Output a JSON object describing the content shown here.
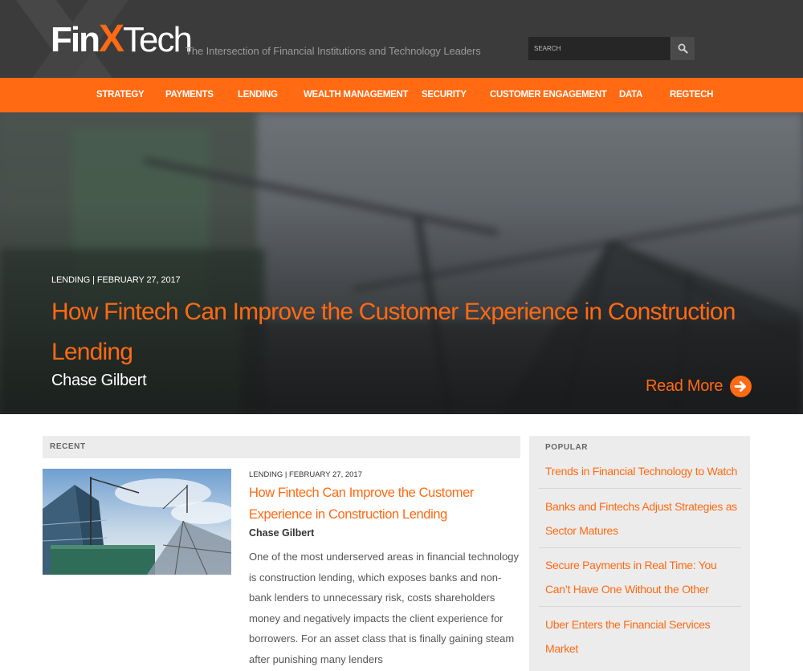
{
  "header": {
    "logo": {
      "fin": "Fin",
      "x": "X",
      "tech": "Tech"
    },
    "tagline": "The Intersection of Financial Institutions and Technology Leaders",
    "search": {
      "placeholder": "SEARCH",
      "icon": "search-icon"
    }
  },
  "nav": {
    "items": [
      {
        "label": "STRATEGY"
      },
      {
        "label": "PAYMENTS"
      },
      {
        "label": "LENDING"
      },
      {
        "label": "WEALTH MANAGEMENT"
      },
      {
        "label": "SECURITY"
      },
      {
        "label": "CUSTOMER ENGAGEMENT"
      },
      {
        "label": "DATA"
      },
      {
        "label": "REGTECH"
      }
    ]
  },
  "hero": {
    "meta": "LENDING | FEBRUARY 27, 2017",
    "title": "How Fintech Can Improve the Customer Experience in Construction Lending",
    "author": "Chase Gilbert",
    "read_more": "Read More",
    "read_more_icon": "arrow-circle-right-icon"
  },
  "recent": {
    "heading": "RECENT",
    "article": {
      "meta": "LENDING | FEBRUARY 27, 2017",
      "title": "How Fintech Can Improve the Customer Experience in Construction Lending",
      "author": "Chase Gilbert",
      "excerpt": "One of the most underserved areas in financial technology is construction lending, which exposes banks and non-bank lenders to unnecessary risk, costs shareholders money and negatively impacts the client experience for borrowers. For an asset class that is finally gaining steam after punishing many lenders"
    }
  },
  "popular": {
    "heading": "POPULAR",
    "items": [
      {
        "title": "Trends in Financial Technology to Watch"
      },
      {
        "title": "Banks and Fintechs Adjust Strategies as Sector Matures"
      },
      {
        "title": "Secure Payments in Real Time: You Can’t Have One Without the Other"
      },
      {
        "title": "Uber Enters the Financial Services Market"
      }
    ]
  },
  "colors": {
    "brand_orange": "#ff6a13",
    "header_dark": "#3b3b3b"
  }
}
